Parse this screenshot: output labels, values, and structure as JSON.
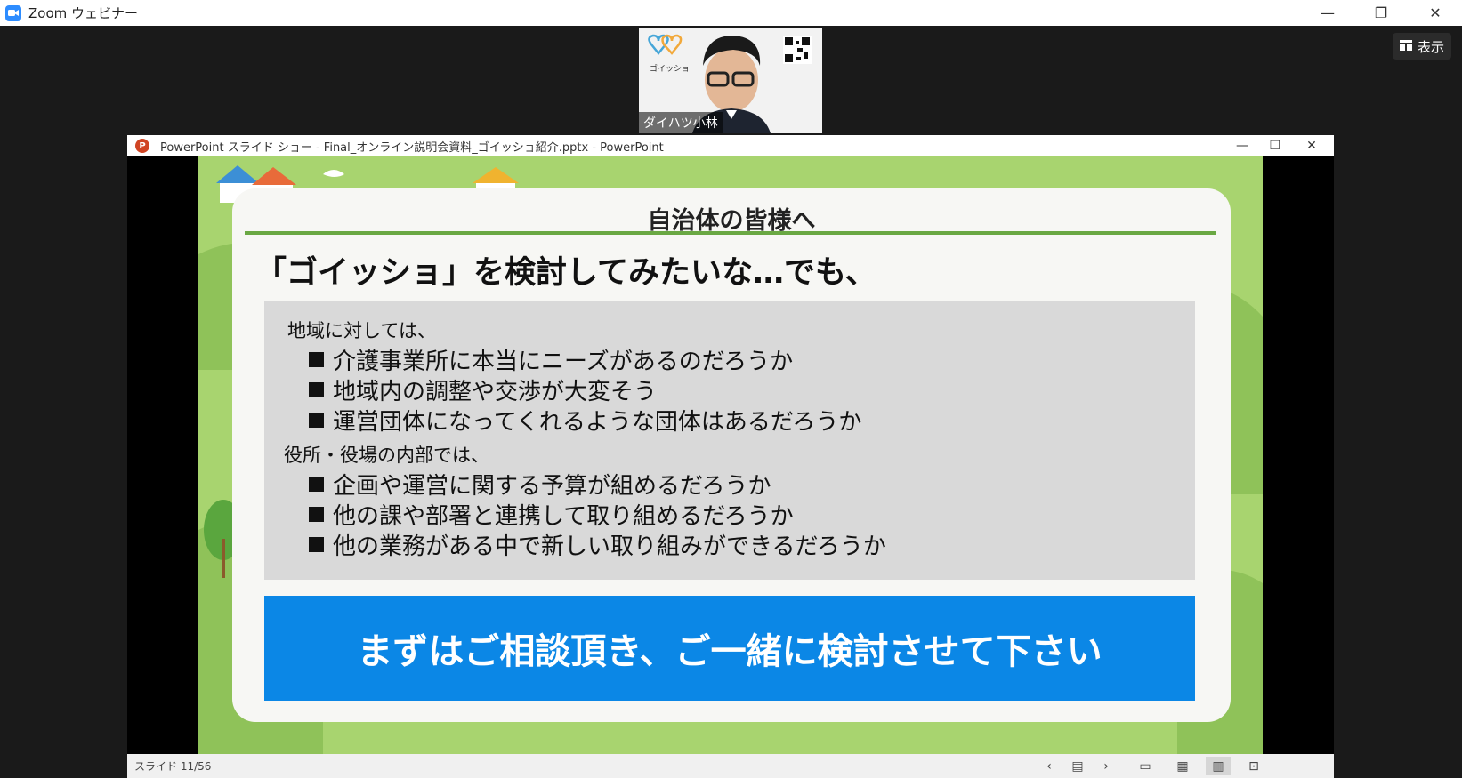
{
  "zoom": {
    "title": "Zoom ウェビナー",
    "view_label": "表示",
    "minimize": "—",
    "restore": "❐",
    "close": "✕"
  },
  "video": {
    "participant_name": "ダイハツ小林",
    "logo_text": "ゴイッショ"
  },
  "ppt": {
    "window_title": "PowerPoint スライド ショー  -  Final_オンライン説明会資料_ゴイッショ紹介.pptx - PowerPoint",
    "icon_letter": "P",
    "minimize": "—",
    "restore": "❐",
    "close": "✕",
    "status": "スライド 11/56"
  },
  "slide": {
    "heading": "自治体の皆様へ",
    "question": "「ゴイッショ」を検討してみたいな…でも、",
    "section1_label": "地域に対しては、",
    "section1_items": [
      "介護事業所に本当にニーズがあるのだろうか",
      "地域内の調整や交渉が大変そう",
      "運営団体になってくれるような団体はあるだろうか"
    ],
    "section2_label": "役所・役場の内部では、",
    "section2_items": [
      "企画や運営に関する予算が組めるだろうか",
      "他の課や部署と連携して取り組めるだろうか",
      "他の業務がある中で新しい取り組みができるだろうか"
    ],
    "banner": "まずはご相談頂き、ご一緒に検討させて下さい"
  },
  "colors": {
    "slide_bg": "#a8d46f",
    "banner": "#0b87e6",
    "rule": "#6aa843"
  }
}
